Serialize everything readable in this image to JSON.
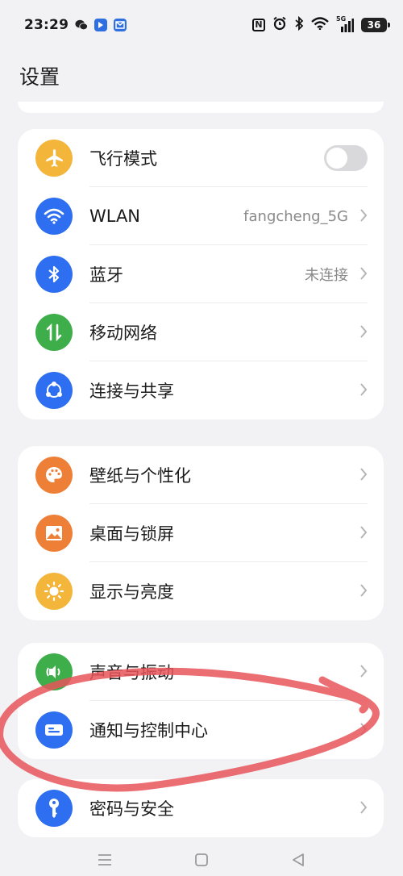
{
  "status_bar": {
    "time": "23:29",
    "battery": "36",
    "network": "5G",
    "left_icons": [
      "wechat-icon",
      "app-icon",
      "mail-icon"
    ],
    "right_icons": [
      "nfc-icon",
      "alarm-icon",
      "bluetooth-icon",
      "wifi-icon",
      "signal-icon",
      "battery-icon"
    ]
  },
  "header": {
    "title": "设置"
  },
  "groups": [
    {
      "items": [
        {
          "label": "飞行模式",
          "icon": "airplane-icon",
          "color": "#f4b53b",
          "control": "toggle",
          "toggle_on": false
        },
        {
          "label": "WLAN",
          "icon": "wifi-icon",
          "color": "#2e6ef0",
          "value": "fangcheng_5G"
        },
        {
          "label": "蓝牙",
          "icon": "bluetooth-icon",
          "color": "#2e6ef0",
          "value": "未连接"
        },
        {
          "label": "移动网络",
          "icon": "mobile-data-icon",
          "color": "#3eae4b"
        },
        {
          "label": "连接与共享",
          "icon": "share-icon",
          "color": "#2e6ef0"
        }
      ]
    },
    {
      "items": [
        {
          "label": "壁纸与个性化",
          "icon": "palette-icon",
          "color": "#ee7f36"
        },
        {
          "label": "桌面与锁屏",
          "icon": "image-icon",
          "color": "#ee7f36"
        },
        {
          "label": "显示与亮度",
          "icon": "brightness-icon",
          "color": "#f4b53b"
        }
      ]
    },
    {
      "items": [
        {
          "label": "声音与振动",
          "icon": "sound-icon",
          "color": "#3eae4b"
        },
        {
          "label": "通知与控制中心",
          "icon": "notification-icon",
          "color": "#2e6ef0"
        }
      ]
    },
    {
      "items": [
        {
          "label": "密码与安全",
          "icon": "key-icon",
          "color": "#2e6ef0"
        }
      ]
    }
  ],
  "nav": {
    "buttons": [
      "menu-icon",
      "home-icon",
      "back-icon"
    ]
  },
  "annotation": {
    "color": "#e8555b"
  }
}
